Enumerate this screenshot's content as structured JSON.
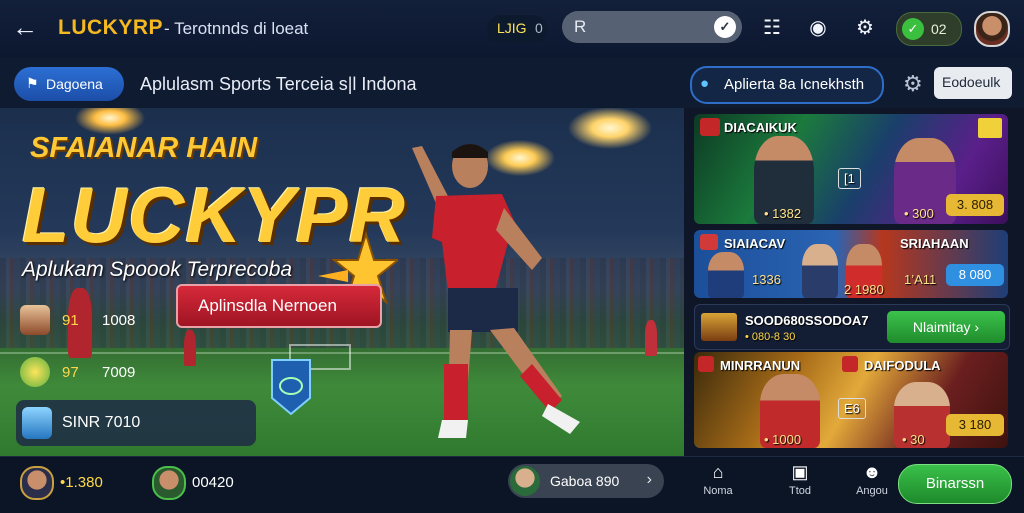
{
  "topbar": {
    "brand": "LUCKYRP",
    "subtitle": "- Terotnnds di loeat",
    "balance_a": "LJIG",
    "balance_b": "0",
    "search_placeholder": "R",
    "coins": "02"
  },
  "bar2": {
    "active_tab": "Dagoena",
    "title": "Aplulasm Sports Terceia s|l Indona",
    "app_button": "Aplierta 8a Icnekhsth",
    "right_button": "Eodoeulk"
  },
  "hero": {
    "kicker": "SFAIANAR HAIN",
    "title": "LUCKYPR",
    "subtitle": "Aplukam Spoook Terprecoba",
    "cta": "Aplinsdla Nernoen",
    "stats": [
      {
        "a": "91",
        "b": "1008"
      },
      {
        "a": "97",
        "b": "7009"
      }
    ],
    "stat_box": "SINR 7010"
  },
  "cards": {
    "c1_title": "DIACAIKUK",
    "c1_score": "• 1382",
    "c1_badge": "[1",
    "c1_right_score": "• 300",
    "c1_btn": "3. 808",
    "c2_title": "SIAIACAV",
    "c2_score_left": "1336",
    "c2_score_mid": "2 1980",
    "c2_title_right": "SRIAHAAN",
    "c2_score_right": "1’A11",
    "c2_btn": "8 080",
    "c3_title": "SOOD680SSODOA7",
    "c3_sub": "• 080-8 30",
    "c3_btn": "Nlaimitay",
    "c4_title": "MINRRANUN",
    "c4_title_right": "DAIFODULA",
    "c4_badge": "E6",
    "c4_score_left": "• 1000",
    "c4_score_right": "• 30",
    "c4_btn": "3 180"
  },
  "bottom": {
    "p1": "•1.380",
    "p2": "00420",
    "watch": "Gaboa 890",
    "nav": [
      {
        "label": "Noma",
        "icon": "home-icon"
      },
      {
        "label": "Ttod",
        "icon": "inbox-icon"
      },
      {
        "label": "Angou",
        "icon": "profile-icon"
      }
    ],
    "big_btn": "Binarssn"
  },
  "colors": {
    "accent_gold": "#ffcd3a",
    "cta_red": "#d6293a",
    "primary_green": "#3ac04a",
    "tab_blue": "#2c6fd4"
  }
}
